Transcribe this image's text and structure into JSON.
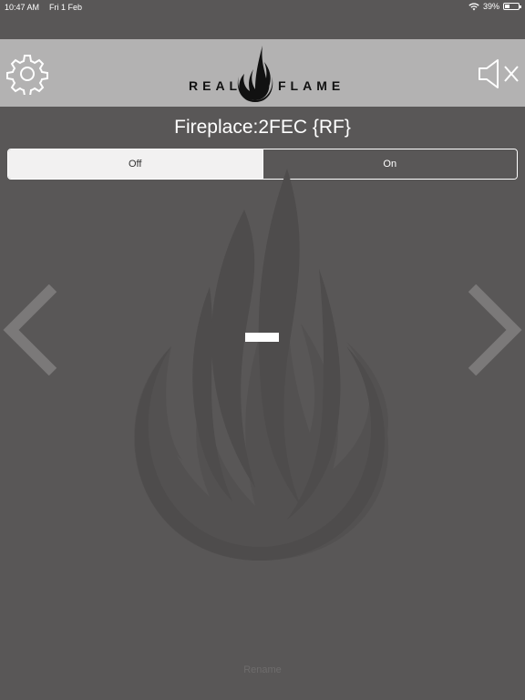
{
  "status_bar": {
    "time": "10:47 AM",
    "date": "Fri 1 Feb",
    "battery": "39%",
    "battery_level": 0.39
  },
  "header": {
    "brand_left": "REAL",
    "brand_right": "FLAME",
    "settings_icon": "gear-icon",
    "mute_icon": "speaker-muted-icon",
    "background": "#b3b2b2"
  },
  "device": {
    "title": "Fireplace:2FEC {RF}",
    "power_options": [
      "Off",
      "On"
    ],
    "selected_power": "Off",
    "level_display": "—"
  },
  "navigation": {
    "prev_icon": "chevron-left-icon",
    "next_icon": "chevron-right-icon"
  },
  "footer": {
    "rename_label": "Rename"
  },
  "colors": {
    "background": "#595757",
    "accent": "#ffffff",
    "selected_segment": "#f2f1f1"
  }
}
